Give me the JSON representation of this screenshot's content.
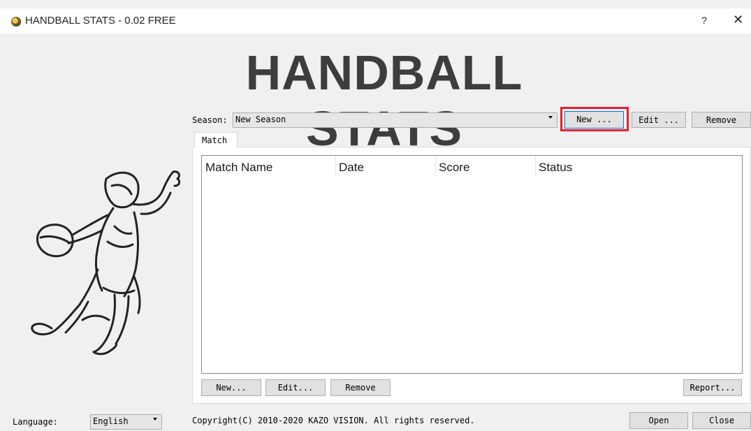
{
  "window": {
    "title": "HANDBALL STATS - 0.02 FREE",
    "help": "?",
    "close": "✕"
  },
  "banner": "HANDBALL STATS",
  "season": {
    "label": "Season:",
    "selected": "New Season",
    "new_button": "New ...",
    "edit_button": "Edit ...",
    "remove_button": "Remove"
  },
  "tabs": [
    {
      "label": "Match"
    }
  ],
  "table": {
    "columns": [
      "Match Name",
      "Date",
      "Score",
      "Status"
    ],
    "rows": []
  },
  "match_buttons": {
    "new": "New...",
    "edit": "Edit...",
    "remove": "Remove",
    "report": "Report..."
  },
  "footer": {
    "language_label": "Language:",
    "language_value": "English",
    "copyright": "Copyright(C) 2010-2020 KAZO VISION. All rights reserved.",
    "open": "Open",
    "close": "Close"
  },
  "colors": {
    "highlight": "#e8202a",
    "banner": "#3d3d3d",
    "background": "#f0f0f0"
  }
}
